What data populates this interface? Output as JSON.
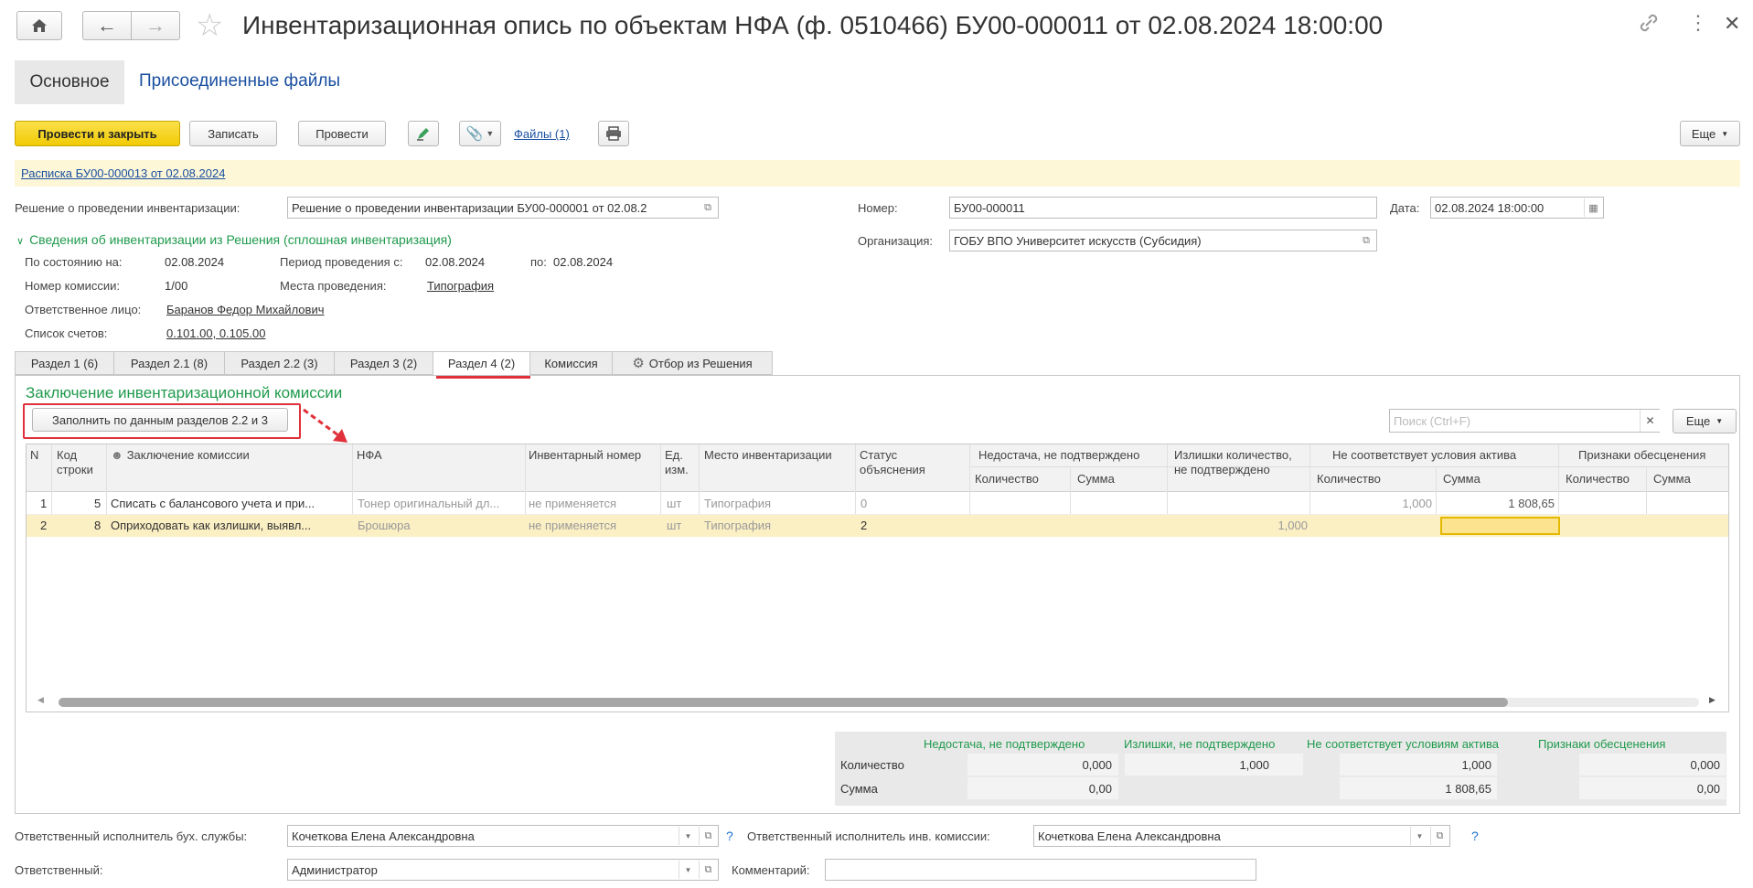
{
  "window": {
    "title": "Инвентаризационная опись по объектам НФА (ф. 0510466) БУ00-000011 от 02.08.2024 18:00:00",
    "nav_tabs": [
      "Основное",
      "Присоединенные файлы"
    ]
  },
  "toolbar": {
    "post_close": "Провести и закрыть",
    "save": "Записать",
    "post": "Провести",
    "files_link": "Файлы (1)",
    "more": "Еще"
  },
  "banner": {
    "link": "Расписка БУ00-000013 от 02.08.2024"
  },
  "form": {
    "decision_label": "Решение о проведении инвентаризации:",
    "decision_value": "Решение о проведении инвентаризации БУ00-000001 от 02.08.2",
    "number_label": "Номер:",
    "number_value": "БУ00-000011",
    "date_label": "Дата:",
    "date_value": "02.08.2024 18:00:00",
    "org_label": "Организация:",
    "org_value": "ГОБУ ВПО Университет искусств (Субсидия)"
  },
  "info": {
    "header": "Сведения об инвентаризации из Решения (сплошная инвентаризация)",
    "as_of_label": "По состоянию на:",
    "as_of_value": "02.08.2024",
    "period_label": "Период проведения с:",
    "period_from": "02.08.2024",
    "period_to_label": "по:",
    "period_to": "02.08.2024",
    "commission_label": "Номер комиссии:",
    "commission_value": "1/00",
    "places_label": "Места проведения:",
    "places_value": "Типография",
    "responsible_label": "Ответственное лицо:",
    "responsible_value": "Баранов Федор Михайлович",
    "accounts_label": "Список счетов:",
    "accounts_value": "0.101.00, 0.105.00"
  },
  "tabs": [
    "Раздел 1 (6)",
    "Раздел 2.1 (8)",
    "Раздел 2.2 (3)",
    "Раздел 3 (2)",
    "Раздел 4 (2)",
    "Комиссия",
    "Отбор из Решения"
  ],
  "section": {
    "title": "Заключение инвентаризационной комиссии",
    "fill_button": "Заполнить по данным разделов 2.2 и 3",
    "search_placeholder": "Поиск (Ctrl+F)",
    "more": "Еще"
  },
  "table": {
    "headers": {
      "n": "N",
      "code1": "Код",
      "code2": "строки",
      "conclusion": "Заключение комиссии",
      "nfa": "НФА",
      "inv": "Инвентарный номер",
      "unit1": "Ед.",
      "unit2": "изм.",
      "place": "Место инвентаризации",
      "status1": "Статус",
      "status2": "объяснения",
      "shortage": "Недостача, не подтверждено",
      "surplus1": "Излишки количество,",
      "surplus2": "не подтверждено",
      "nonconf": "Не соответствует условия актива",
      "impair": "Признаки обесценения",
      "qty": "Количество",
      "sum": "Сумма"
    },
    "rows": [
      {
        "n": "1",
        "code": "5",
        "conclusion": "Списать с балансового учета и при...",
        "nfa": "Тонер оригинальный дл...",
        "inv": "не применяется",
        "unit": "шт",
        "place": "Типография",
        "status": "0",
        "short_qty": "",
        "short_sum": "",
        "surplus": "",
        "nc_qty": "1,000",
        "nc_sum": "1 808,65",
        "imp_qty": "",
        "imp_sum": ""
      },
      {
        "n": "2",
        "code": "8",
        "conclusion": "Оприходовать как излишки, выявл...",
        "nfa": "Брошюра",
        "inv": "не применяется",
        "unit": "шт",
        "place": "Типография",
        "status": "2",
        "short_qty": "",
        "short_sum": "",
        "surplus": "1,000",
        "nc_qty": "",
        "nc_sum": "",
        "imp_qty": "",
        "imp_sum": ""
      }
    ]
  },
  "totals": {
    "headers": [
      "Недостача, не подтверждено",
      "Излишки, не подтверждено",
      "Не соответствует условиям актива",
      "Признаки обесценения"
    ],
    "qty_label": "Количество",
    "sum_label": "Сумма",
    "qty": [
      "0,000",
      "1,000",
      "1,000",
      "0,000"
    ],
    "sum": [
      "0,00",
      "",
      "1 808,65",
      "0,00"
    ]
  },
  "footer": {
    "acc_exec_label": "Ответственный исполнитель бух. службы:",
    "acc_exec_value": "Кочеткова Елена Александровна",
    "inv_exec_label": "Ответственный исполнитель инв. комиссии:",
    "inv_exec_value": "Кочеткова Елена Александровна",
    "responsible_label": "Ответственный:",
    "responsible_value": "Администратор",
    "comment_label": "Комментарий:",
    "comment_value": "",
    "help": "?"
  },
  "colors": {
    "accent_yellow": "#f5d20f",
    "green": "#1f9a4c",
    "red_highlight": "#e0303a",
    "selected_row": "#fbefc4"
  }
}
